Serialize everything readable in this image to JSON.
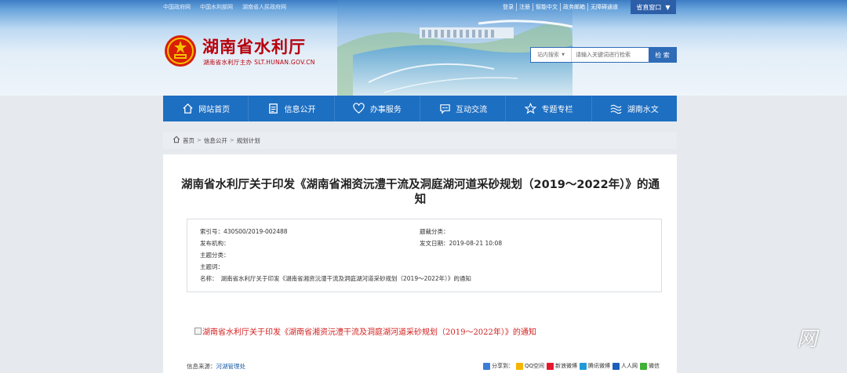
{
  "topbar": {
    "links": [
      "中国政府网",
      "中国水利部网",
      "湖南省人民政府网"
    ],
    "user_links": [
      "登录",
      "注册",
      "智能中文",
      "政务邮箱",
      "无障碍通道"
    ],
    "portal_label": "省直窗口"
  },
  "header": {
    "site_name": "湖南省水利厅",
    "site_sub": "湖南省水利厅主办 SLT.HUNAN.GOV.CN",
    "search_scope": "站内搜索",
    "search_placeholder": "请输入关键词进行检索",
    "search_button": "检 索"
  },
  "nav": {
    "items": [
      {
        "label": "网站首页",
        "icon": "home-icon"
      },
      {
        "label": "信息公开",
        "icon": "document-icon"
      },
      {
        "label": "办事服务",
        "icon": "heart-icon"
      },
      {
        "label": "互动交流",
        "icon": "chat-icon"
      },
      {
        "label": "专题专栏",
        "icon": "star-icon"
      },
      {
        "label": "湖南水文",
        "icon": "wave-icon"
      }
    ]
  },
  "breadcrumb": {
    "items": [
      "首页",
      "信息公开",
      "规划计划"
    ]
  },
  "article": {
    "title": "湖南省水利厅关于印发《湖南省湘资沅澧干流及洞庭湖河道采砂规划（2019～2022年）》的通知",
    "meta": {
      "index_label": "索引号：",
      "index_value": "430S00/2019-002488",
      "topic_label": "题裁分类：",
      "topic_value": "",
      "org_label": "发布机构：",
      "org_value": "",
      "date_label": "发文日期：",
      "date_value": "2019-08-21 10:08",
      "theme_label": "主题分类：",
      "theme_value": "",
      "keywords_label": "主题词：",
      "keywords_value": "",
      "name_label": "名称：",
      "name_value": "湖南省水利厅关于印发《湖南省湘资沅澧干流及洞庭湖河道采砂规划（2019～2022年）》的通知"
    },
    "image_alt": "湖南省水利厅关于印发《湖南省湘资沅澧干流及洞庭湖河道采砂规划（2019～2022年）》的通知",
    "source_label": "信息来源：",
    "source_value": "河湖管理处",
    "share_label": "分享到：",
    "share_items": [
      "QQ空间",
      "新浪微博",
      "腾讯微博",
      "人人网",
      "微信"
    ]
  },
  "colors": {
    "nav_bg": "#1d6fc2",
    "brand_red": "#b8000b",
    "page_bg": "#e6e9ee"
  }
}
